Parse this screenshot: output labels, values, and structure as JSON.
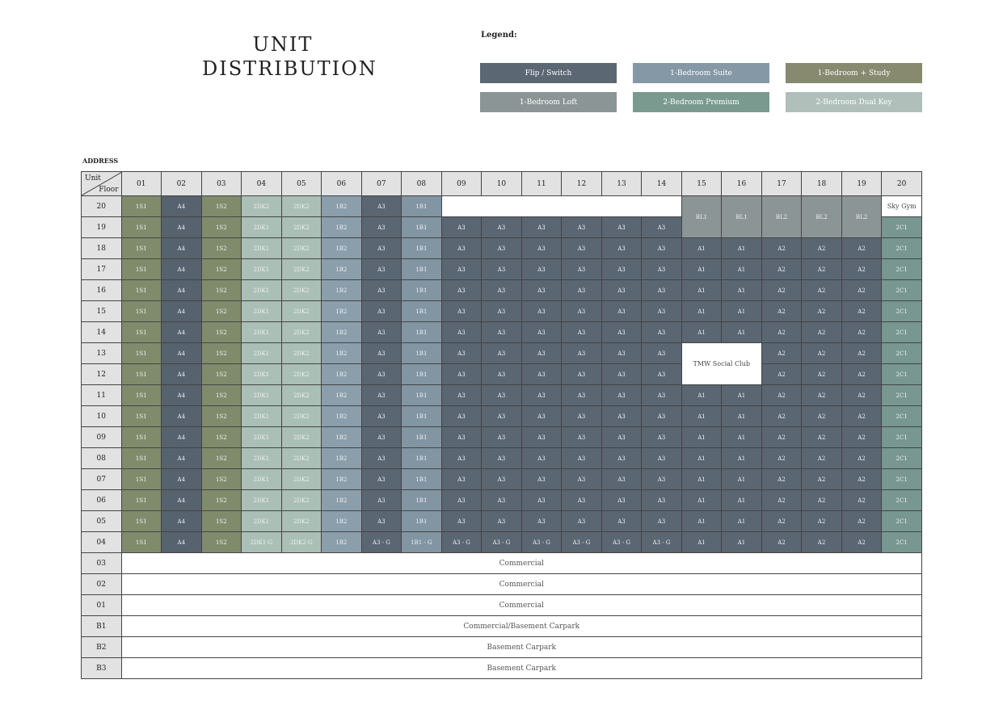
{
  "title_line1": "UNIT",
  "title_line2": "DISTRIBUTION",
  "legend_label": "Legend:",
  "legend": [
    {
      "label": "Flip / Switch",
      "color": "#5b6773"
    },
    {
      "label": "1-Bedroom Suite",
      "color": "#8598a6"
    },
    {
      "label": "1-Bedroom + Study",
      "color": "#878a6f"
    },
    {
      "label": "1-Bedroom Loft",
      "color": "#8c9595"
    },
    {
      "label": "2-Bedroom Premium",
      "color": "#7a9a90"
    },
    {
      "label": "2-Bedroom Dual Key",
      "color": "#b0bfb9"
    }
  ],
  "colors": {
    "1S": "#808b6c",
    "A4": "#56626e",
    "2DK": "#aabfb6",
    "1B2": "#8a9eab",
    "A3": "#5a6672",
    "1B1": "#8195a3",
    "A1": "#5a6672",
    "A2": "#5a6672",
    "2C1": "#779790",
    "BL": "#8c9595"
  },
  "address_label": "ADDRESS",
  "corner": {
    "unit": "Unit",
    "floor": "Floor"
  },
  "stacks": [
    "01",
    "02",
    "03",
    "04",
    "05",
    "06",
    "07",
    "08",
    "09",
    "10",
    "11",
    "12",
    "13",
    "14",
    "15",
    "16",
    "17",
    "18",
    "19",
    "20"
  ],
  "standard_row": [
    "1S1",
    "A4",
    "1S2",
    "2DK1",
    "2DK2",
    "1B2",
    "A3",
    "1B1",
    "A3",
    "A3",
    "A3",
    "A3",
    "A3",
    "A3",
    "A1",
    "A1",
    "A2",
    "A2",
    "A2",
    "2C1"
  ],
  "standard_floors": [
    "18",
    "17",
    "16",
    "15",
    "14",
    "11",
    "10",
    "09",
    "08",
    "07",
    "06",
    "05"
  ],
  "floor_20": {
    "floor": "20",
    "units": [
      "1S1",
      "A4",
      "1S2",
      "2DK2",
      "2DK2",
      "1B2",
      "A3",
      "1B1"
    ],
    "sky_gym": "Sky Gym"
  },
  "floor_19": {
    "floor": "19",
    "units": [
      "1S1",
      "A4",
      "1S2",
      "2DK1",
      "2DK2",
      "1B2",
      "A3",
      "1B1",
      "A3",
      "A3",
      "A3",
      "A3",
      "A3",
      "A3"
    ],
    "unit_20": "2C1"
  },
  "lofts": [
    "BL1",
    "BL1",
    "BL2",
    "BL2",
    "BL2"
  ],
  "floor_13": {
    "floor": "13",
    "units": [
      "1S1",
      "A4",
      "1S2",
      "2DK1",
      "2DK2",
      "1B2",
      "A3",
      "1B1",
      "A3",
      "A3",
      "A3",
      "A3",
      "A3",
      "A3"
    ],
    "tail": [
      "A2",
      "A2",
      "A2",
      "2C1"
    ],
    "social_club": "TMW Social Club"
  },
  "floor_12": {
    "floor": "12",
    "units": [
      "1S1",
      "A4",
      "1S2",
      "2DK1",
      "2DK2",
      "1B2",
      "A3",
      "1B1",
      "A3",
      "A3",
      "A3",
      "A3",
      "A3",
      "A3"
    ],
    "tail": [
      "A2",
      "A2",
      "A2",
      "2C1"
    ]
  },
  "floor_04": {
    "floor": "04",
    "units": [
      "1S1",
      "A4",
      "1S2",
      "2DK1-G",
      "2DK2-G",
      "1B2",
      "A3 - G",
      "1B1 - G",
      "A3 - G",
      "A3 - G",
      "A3 - G",
      "A3 - G",
      "A3 - G",
      "A3 - G",
      "A1",
      "A1",
      "A2",
      "A2",
      "A2",
      "2C1"
    ]
  },
  "lower_floors": [
    {
      "floor": "03",
      "use": "Commercial"
    },
    {
      "floor": "02",
      "use": "Commercial"
    },
    {
      "floor": "01",
      "use": "Commercial"
    },
    {
      "floor": "B1",
      "use": "Commercial/Basement Carpark"
    },
    {
      "floor": "B2",
      "use": "Basement Carpark"
    },
    {
      "floor": "B3",
      "use": "Basement Carpark"
    }
  ]
}
